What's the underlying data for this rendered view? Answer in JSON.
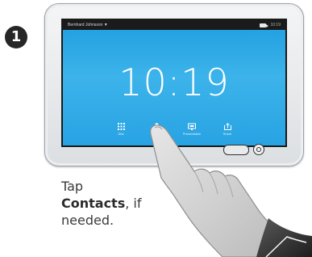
{
  "step": {
    "number": "1"
  },
  "device": {
    "status_bar": {
      "user": "Bernhard Johnsson ▼",
      "time": "10:19"
    },
    "clock": "10:19",
    "dock": [
      {
        "label": "Dial",
        "icon": "grid-icon"
      },
      {
        "label": "Contacts",
        "icon": "contact-icon"
      },
      {
        "label": "Presentation",
        "icon": "presentation-icon"
      },
      {
        "label": "Share",
        "icon": "share-icon"
      }
    ]
  },
  "instruction": {
    "line1": "Tap",
    "bold": "Contacts",
    "line2_suffix": ", if",
    "line3": "needed."
  },
  "colors": {
    "screen_blue": "#2aa6e4",
    "status_bar": "#1b1b1b",
    "badge": "#262626"
  }
}
